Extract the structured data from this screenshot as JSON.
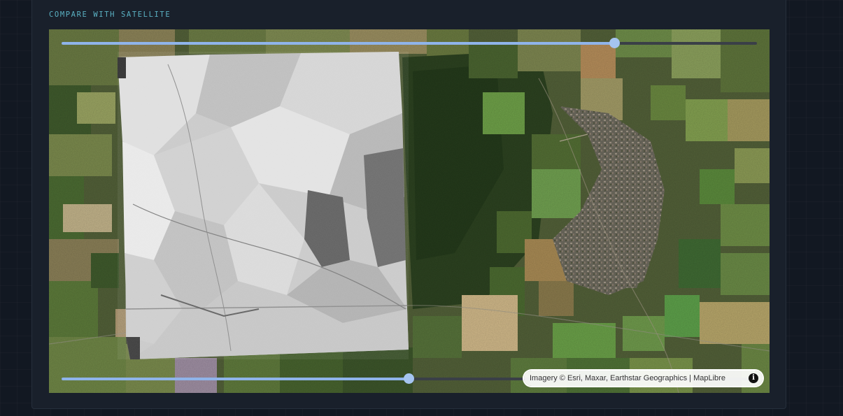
{
  "panel": {
    "title": "COMPARE WITH SATELLITE"
  },
  "map": {
    "attribution": "Imagery © Esri, Maxar, Earthstar Geographics | MapLibre",
    "info_icon": "i"
  },
  "sliders": {
    "top": {
      "value": 0.795
    },
    "bottom": {
      "value": 0.499
    }
  },
  "colors": {
    "accent": "#5ab0c2",
    "slider_fill": "#8fb4ea",
    "slider_track": "#3a3f47"
  }
}
